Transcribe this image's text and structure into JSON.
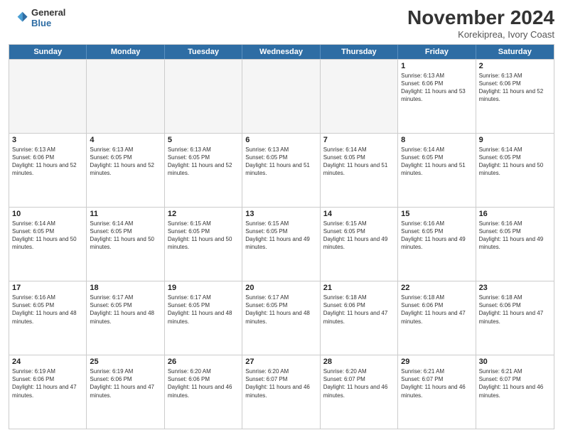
{
  "header": {
    "month_title": "November 2024",
    "location": "Korekiprea, Ivory Coast",
    "logo_line1": "General",
    "logo_line2": "Blue"
  },
  "days_of_week": [
    "Sunday",
    "Monday",
    "Tuesday",
    "Wednesday",
    "Thursday",
    "Friday",
    "Saturday"
  ],
  "weeks": [
    [
      {
        "day": "",
        "empty": true
      },
      {
        "day": "",
        "empty": true
      },
      {
        "day": "",
        "empty": true
      },
      {
        "day": "",
        "empty": true
      },
      {
        "day": "",
        "empty": true
      },
      {
        "day": "1",
        "sunrise": "6:13 AM",
        "sunset": "6:06 PM",
        "daylight": "11 hours and 53 minutes."
      },
      {
        "day": "2",
        "sunrise": "6:13 AM",
        "sunset": "6:06 PM",
        "daylight": "11 hours and 52 minutes."
      }
    ],
    [
      {
        "day": "3",
        "sunrise": "6:13 AM",
        "sunset": "6:06 PM",
        "daylight": "11 hours and 52 minutes."
      },
      {
        "day": "4",
        "sunrise": "6:13 AM",
        "sunset": "6:05 PM",
        "daylight": "11 hours and 52 minutes."
      },
      {
        "day": "5",
        "sunrise": "6:13 AM",
        "sunset": "6:05 PM",
        "daylight": "11 hours and 52 minutes."
      },
      {
        "day": "6",
        "sunrise": "6:13 AM",
        "sunset": "6:05 PM",
        "daylight": "11 hours and 51 minutes."
      },
      {
        "day": "7",
        "sunrise": "6:14 AM",
        "sunset": "6:05 PM",
        "daylight": "11 hours and 51 minutes."
      },
      {
        "day": "8",
        "sunrise": "6:14 AM",
        "sunset": "6:05 PM",
        "daylight": "11 hours and 51 minutes."
      },
      {
        "day": "9",
        "sunrise": "6:14 AM",
        "sunset": "6:05 PM",
        "daylight": "11 hours and 50 minutes."
      }
    ],
    [
      {
        "day": "10",
        "sunrise": "6:14 AM",
        "sunset": "6:05 PM",
        "daylight": "11 hours and 50 minutes."
      },
      {
        "day": "11",
        "sunrise": "6:14 AM",
        "sunset": "6:05 PM",
        "daylight": "11 hours and 50 minutes."
      },
      {
        "day": "12",
        "sunrise": "6:15 AM",
        "sunset": "6:05 PM",
        "daylight": "11 hours and 50 minutes."
      },
      {
        "day": "13",
        "sunrise": "6:15 AM",
        "sunset": "6:05 PM",
        "daylight": "11 hours and 49 minutes."
      },
      {
        "day": "14",
        "sunrise": "6:15 AM",
        "sunset": "6:05 PM",
        "daylight": "11 hours and 49 minutes."
      },
      {
        "day": "15",
        "sunrise": "6:16 AM",
        "sunset": "6:05 PM",
        "daylight": "11 hours and 49 minutes."
      },
      {
        "day": "16",
        "sunrise": "6:16 AM",
        "sunset": "6:05 PM",
        "daylight": "11 hours and 49 minutes."
      }
    ],
    [
      {
        "day": "17",
        "sunrise": "6:16 AM",
        "sunset": "6:05 PM",
        "daylight": "11 hours and 48 minutes."
      },
      {
        "day": "18",
        "sunrise": "6:17 AM",
        "sunset": "6:05 PM",
        "daylight": "11 hours and 48 minutes."
      },
      {
        "day": "19",
        "sunrise": "6:17 AM",
        "sunset": "6:05 PM",
        "daylight": "11 hours and 48 minutes."
      },
      {
        "day": "20",
        "sunrise": "6:17 AM",
        "sunset": "6:05 PM",
        "daylight": "11 hours and 48 minutes."
      },
      {
        "day": "21",
        "sunrise": "6:18 AM",
        "sunset": "6:06 PM",
        "daylight": "11 hours and 47 minutes."
      },
      {
        "day": "22",
        "sunrise": "6:18 AM",
        "sunset": "6:06 PM",
        "daylight": "11 hours and 47 minutes."
      },
      {
        "day": "23",
        "sunrise": "6:18 AM",
        "sunset": "6:06 PM",
        "daylight": "11 hours and 47 minutes."
      }
    ],
    [
      {
        "day": "24",
        "sunrise": "6:19 AM",
        "sunset": "6:06 PM",
        "daylight": "11 hours and 47 minutes."
      },
      {
        "day": "25",
        "sunrise": "6:19 AM",
        "sunset": "6:06 PM",
        "daylight": "11 hours and 47 minutes."
      },
      {
        "day": "26",
        "sunrise": "6:20 AM",
        "sunset": "6:06 PM",
        "daylight": "11 hours and 46 minutes."
      },
      {
        "day": "27",
        "sunrise": "6:20 AM",
        "sunset": "6:07 PM",
        "daylight": "11 hours and 46 minutes."
      },
      {
        "day": "28",
        "sunrise": "6:20 AM",
        "sunset": "6:07 PM",
        "daylight": "11 hours and 46 minutes."
      },
      {
        "day": "29",
        "sunrise": "6:21 AM",
        "sunset": "6:07 PM",
        "daylight": "11 hours and 46 minutes."
      },
      {
        "day": "30",
        "sunrise": "6:21 AM",
        "sunset": "6:07 PM",
        "daylight": "11 hours and 46 minutes."
      }
    ]
  ]
}
